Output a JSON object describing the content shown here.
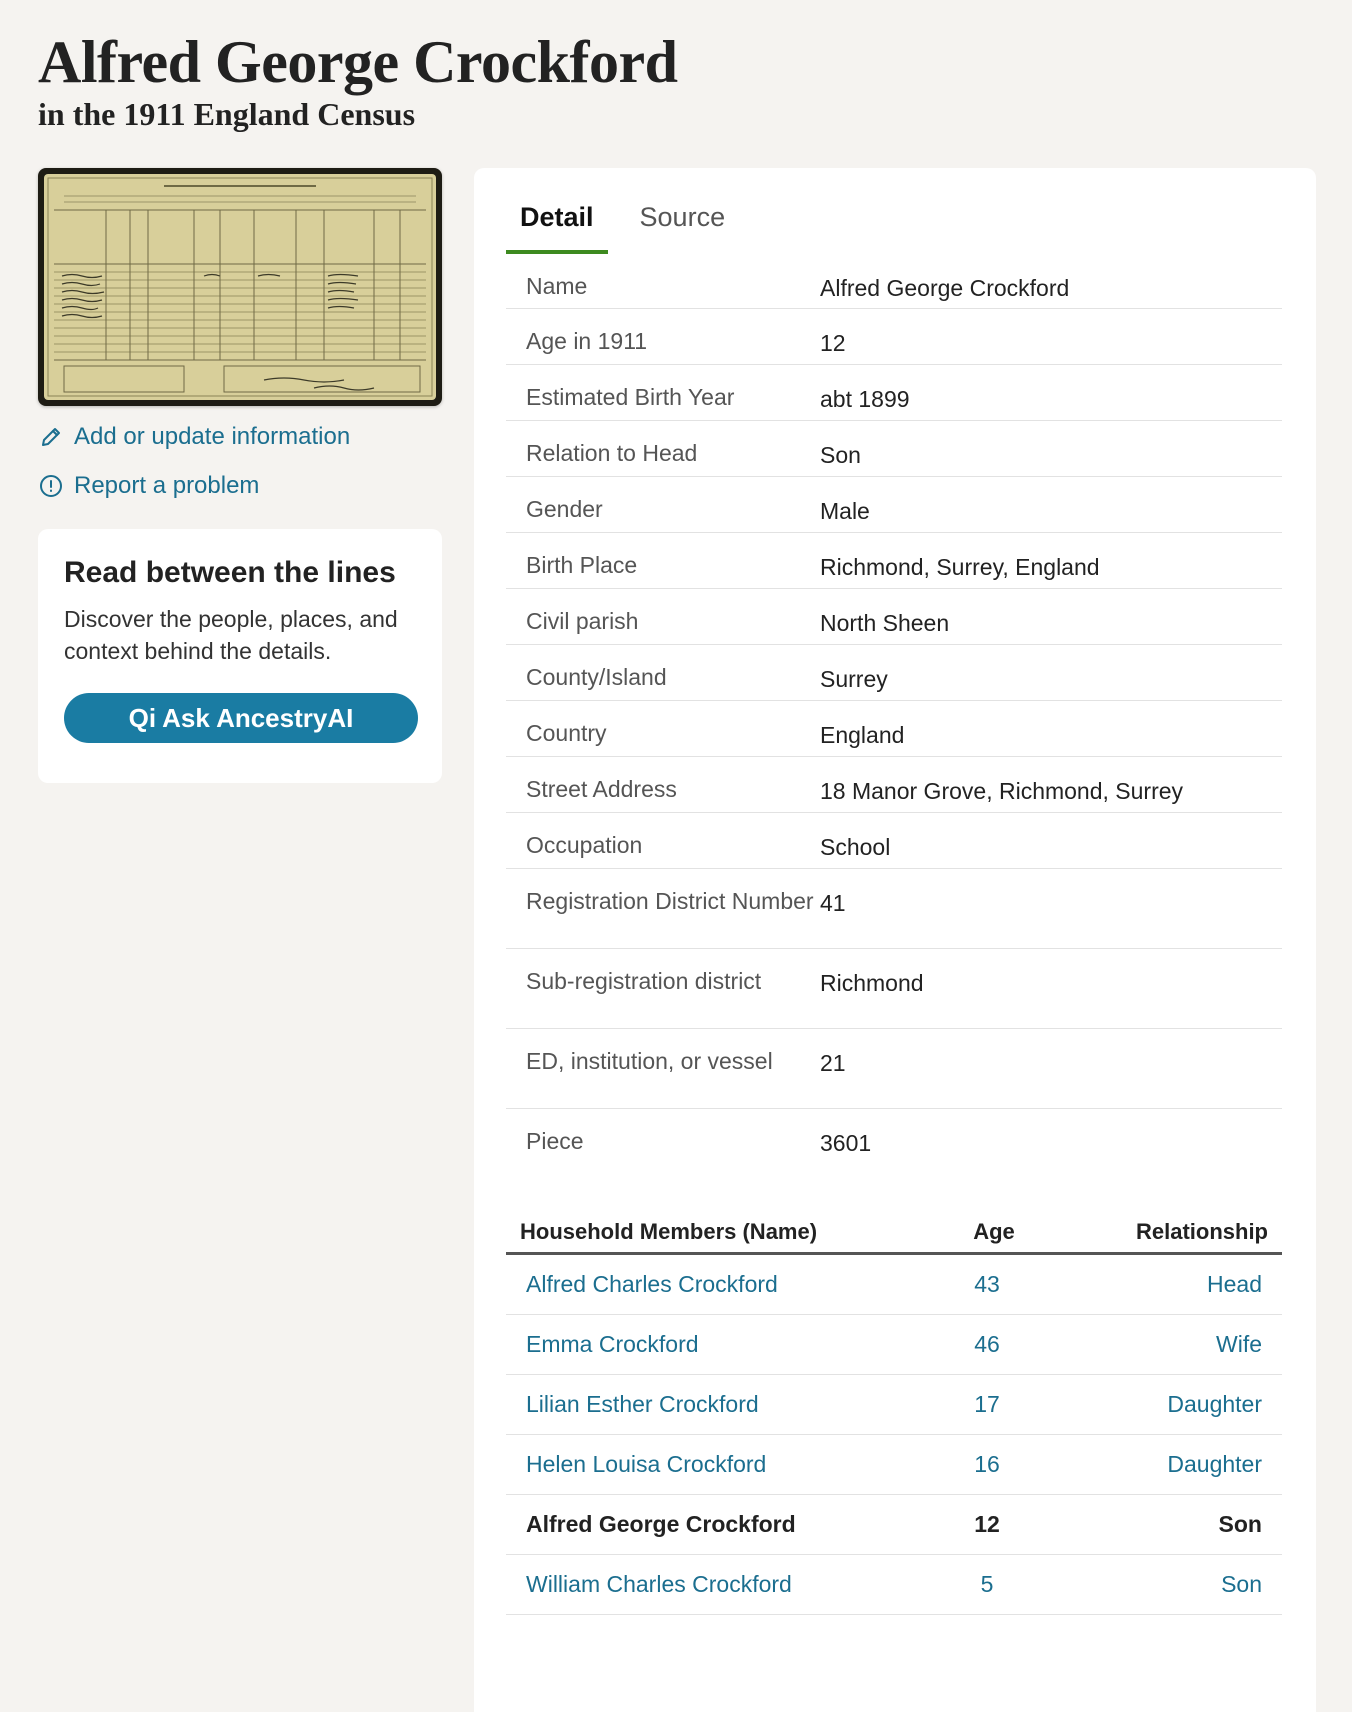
{
  "header": {
    "title": "Alfred George Crockford",
    "subtitle": "in the 1911 England Census"
  },
  "sidebar": {
    "add_update_label": "Add or update information",
    "report_label": "Report a problem",
    "ai_card": {
      "heading": "Read between the lines",
      "body": "Discover the people, places, and context behind the details.",
      "button_label": "Ask AncestryAI",
      "button_mark": "Qi"
    }
  },
  "tabs": [
    {
      "label": "Detail",
      "active": true
    },
    {
      "label": "Source",
      "active": false
    }
  ],
  "details": [
    {
      "label": "Name",
      "value": "Alfred George Crockford"
    },
    {
      "label": "Age in 1911",
      "value": "12"
    },
    {
      "label": "Estimated Birth Year",
      "value": "abt 1899"
    },
    {
      "label": "Relation to Head",
      "value": "Son"
    },
    {
      "label": "Gender",
      "value": "Male"
    },
    {
      "label": "Birth Place",
      "value": "Richmond, Surrey, England"
    },
    {
      "label": "Civil parish",
      "value": "North Sheen"
    },
    {
      "label": "County/Island",
      "value": "Surrey"
    },
    {
      "label": "Country",
      "value": "England"
    },
    {
      "label": "Street Address",
      "value": "18 Manor Grove, Richmond, Surrey"
    },
    {
      "label": "Occupation",
      "value": "School"
    },
    {
      "label": "Registration District Number",
      "value": "41"
    },
    {
      "label": "Sub-registration district",
      "value": "Richmond"
    },
    {
      "label": "ED, institution, or vessel",
      "value": "21"
    },
    {
      "label": "Piece",
      "value": "3601"
    }
  ],
  "household": {
    "headers": {
      "name": "Household Members (Name)",
      "age": "Age",
      "relationship": "Relationship"
    },
    "members": [
      {
        "name": "Alfred Charles Crockford",
        "age": "43",
        "relationship": "Head",
        "current": false
      },
      {
        "name": "Emma Crockford",
        "age": "46",
        "relationship": "Wife",
        "current": false
      },
      {
        "name": "Lilian Esther Crockford",
        "age": "17",
        "relationship": "Daughter",
        "current": false
      },
      {
        "name": "Helen Louisa Crockford",
        "age": "16",
        "relationship": "Daughter",
        "current": false
      },
      {
        "name": "Alfred George Crockford",
        "age": "12",
        "relationship": "Son",
        "current": true
      },
      {
        "name": "William Charles Crockford",
        "age": "5",
        "relationship": "Son",
        "current": false
      }
    ]
  },
  "colors": {
    "link": "#1b6e8f",
    "accent_tab": "#3d8a1f",
    "button": "#1a7ca3",
    "background": "#f5f3f0"
  },
  "icons": {
    "add_update": "pencil-icon",
    "report": "alert-circle-icon"
  }
}
